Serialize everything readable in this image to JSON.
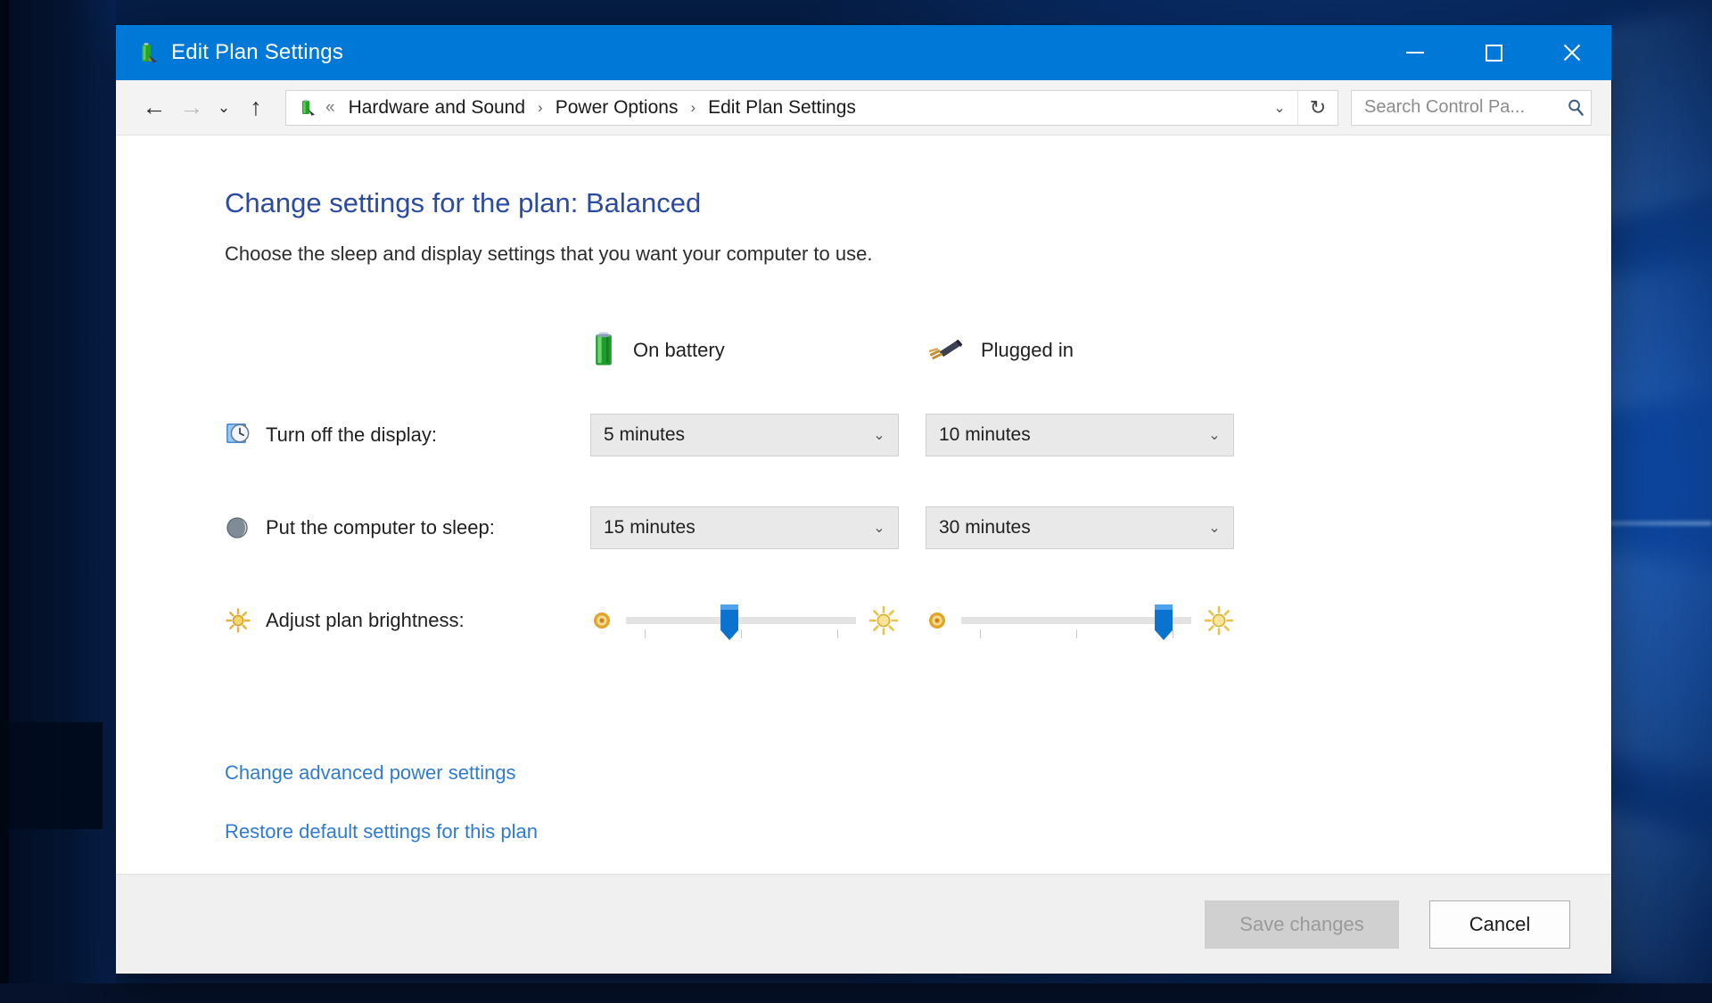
{
  "window": {
    "title": "Edit Plan Settings",
    "title_icon": "battery-plug-icon",
    "accent_color": "#0078d7",
    "controls": {
      "minimize": "minimize-icon",
      "maximize": "maximize-icon",
      "close": "close-icon"
    }
  },
  "nav": {
    "back": "←",
    "forward": "→",
    "recent": "⌄",
    "up": "↑",
    "address_icon": "power-options-icon",
    "root_glyph": "«",
    "breadcrumbs": [
      "Hardware and Sound",
      "Power Options",
      "Edit Plan Settings"
    ],
    "separator": "›",
    "dropdown": "⌄",
    "refresh": "↻"
  },
  "search": {
    "placeholder": "Search Control Pa...",
    "value": "",
    "icon": "search-icon"
  },
  "page": {
    "heading": "Change settings for the plan: Balanced",
    "subtitle": "Choose the sleep and display settings that you want your computer to use.",
    "heading_color": "#2b4ba0"
  },
  "columns": {
    "battery": {
      "label": "On battery",
      "icon": "battery-icon"
    },
    "plugged": {
      "label": "Plugged in",
      "icon": "power-plug-icon"
    }
  },
  "settings": [
    {
      "icon": "display-clock-icon",
      "label": "Turn off the display:",
      "battery_value": "5 minutes",
      "plugged_value": "10 minutes",
      "arrow": "⌄"
    },
    {
      "icon": "sleep-moon-icon",
      "label": "Put the computer to sleep:",
      "battery_value": "15 minutes",
      "plugged_value": "30 minutes",
      "arrow": "⌄"
    }
  ],
  "brightness": {
    "icon": "brightness-sun-icon",
    "label": "Adjust plan brightness:",
    "low_icon": "dim-sun-icon",
    "high_icon": "bright-sun-icon",
    "battery_percent": 45,
    "plugged_percent": 88
  },
  "links": [
    {
      "label": "Change advanced power settings",
      "name": "change-advanced-power-settings-link"
    },
    {
      "label": "Restore default settings for this plan",
      "name": "restore-default-settings-link"
    }
  ],
  "footer": {
    "save_label": "Save changes",
    "save_enabled": false,
    "cancel_label": "Cancel"
  }
}
